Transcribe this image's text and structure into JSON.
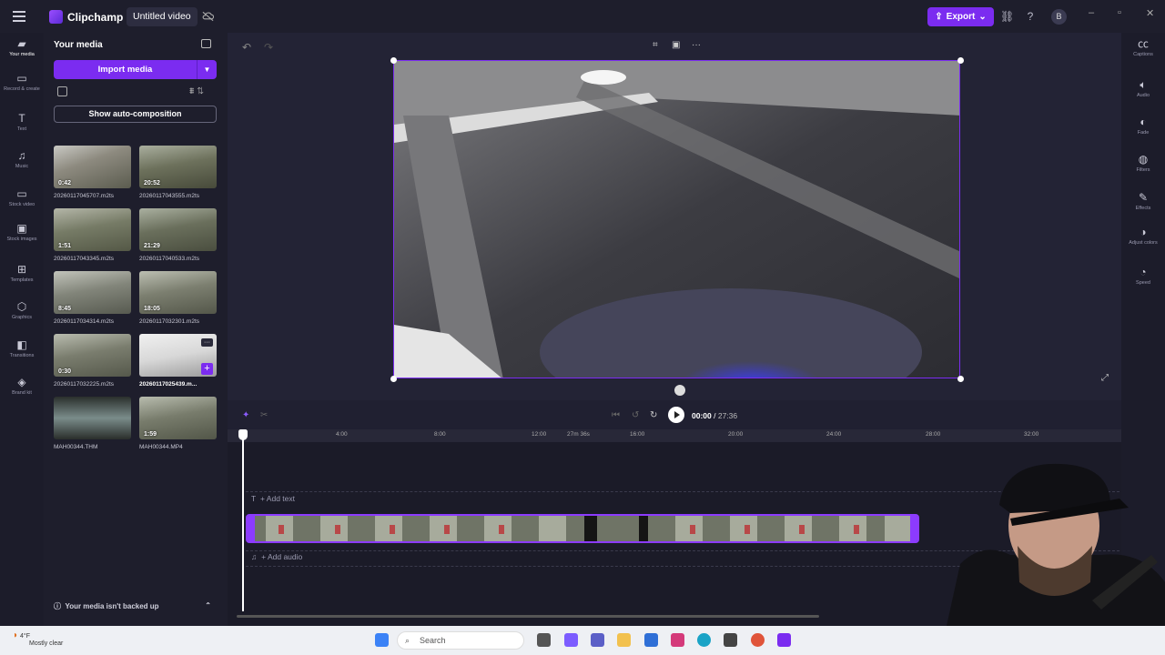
{
  "app": {
    "name": "Clipchamp",
    "project_title": "Untitled video"
  },
  "header": {
    "export_label": "Export",
    "avatar_initial": "B"
  },
  "left_nav": [
    {
      "label": "Your media",
      "icon": "folder-icon"
    },
    {
      "label": "Record & create",
      "icon": "camera-icon"
    },
    {
      "label": "Text",
      "icon": "text-icon"
    },
    {
      "label": "Music",
      "icon": "music-icon"
    },
    {
      "label": "Stock video",
      "icon": "film-icon"
    },
    {
      "label": "Stock images",
      "icon": "image-icon"
    },
    {
      "label": "Templates",
      "icon": "templates-icon"
    },
    {
      "label": "Graphics",
      "icon": "graphics-icon"
    },
    {
      "label": "Transitions",
      "icon": "transitions-icon"
    },
    {
      "label": "Brand kit",
      "icon": "brand-kit-icon"
    }
  ],
  "right_nav": [
    {
      "label": "Captions",
      "icon": "captions-icon"
    },
    {
      "label": "Audio",
      "icon": "speaker-icon"
    },
    {
      "label": "Fade",
      "icon": "fade-icon"
    },
    {
      "label": "Filters",
      "icon": "filters-icon"
    },
    {
      "label": "Effects",
      "icon": "effects-icon"
    },
    {
      "label": "Adjust colors",
      "icon": "adjust-icon"
    },
    {
      "label": "Speed",
      "icon": "speed-icon"
    }
  ],
  "media_panel": {
    "title": "Your media",
    "import_label": "Import media",
    "auto_comp_label": "Show auto-composition",
    "backup_notice": "Your media isn't backed up",
    "items": [
      {
        "name": "20260117045707.m2ts",
        "duration": "0:42"
      },
      {
        "name": "20260117043555.m2ts",
        "duration": "20:52"
      },
      {
        "name": "20260117043345.m2ts",
        "duration": "1:51"
      },
      {
        "name": "20260117040533.m2ts",
        "duration": "21:29"
      },
      {
        "name": "20260117034314.m2ts",
        "duration": "8:45"
      },
      {
        "name": "20260117032301.m2ts",
        "duration": "18:05"
      },
      {
        "name": "20260117032225.m2ts",
        "duration": "0:30"
      },
      {
        "name": "20260117025439.m...",
        "duration": ""
      },
      {
        "name": "MAH00344.THM",
        "duration": ""
      },
      {
        "name": "MAH00344.MP4",
        "duration": "1:59"
      }
    ]
  },
  "player": {
    "current": "00:00",
    "total": "27:36"
  },
  "timeline": {
    "ticks": [
      "4:00",
      "8:00",
      "12:00",
      "16:00",
      "20:00",
      "24:00",
      "28:00",
      "32:00"
    ],
    "marker": "27m 36s",
    "add_text": "+ Add text",
    "add_audio": "+ Add audio"
  },
  "taskbar": {
    "temp": "4°F",
    "condition": "Mostly clear",
    "search_placeholder": "Search"
  },
  "colors": {
    "accent": "#7b2cf0",
    "bg": "#202031"
  }
}
